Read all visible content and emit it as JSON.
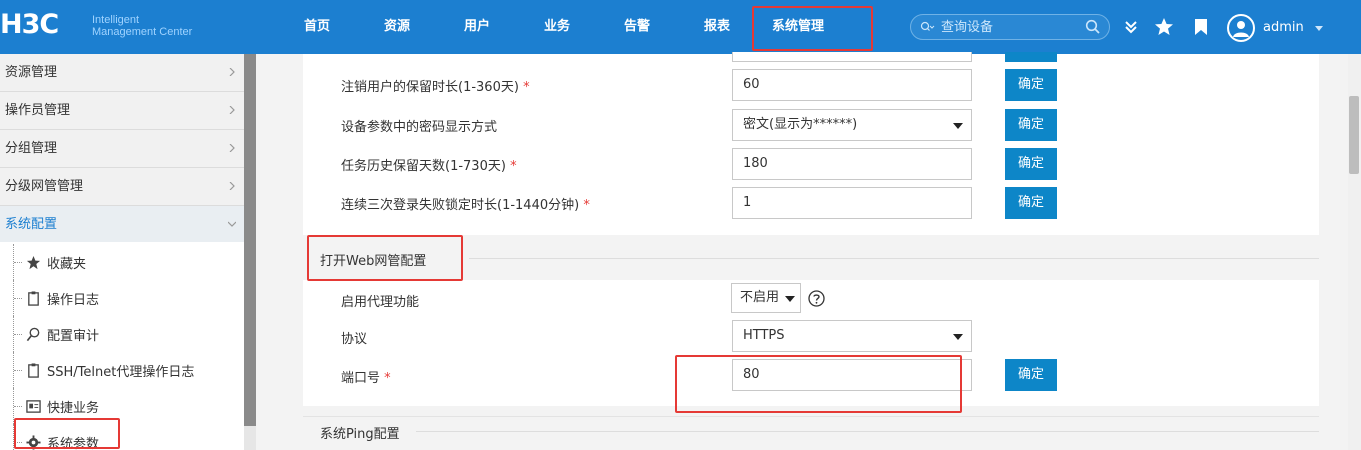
{
  "header": {
    "logo_mark": "H3C",
    "logo_line1": "Intelligent",
    "logo_line2": "Management Center",
    "nav": [
      {
        "label": "首页"
      },
      {
        "label": "资源"
      },
      {
        "label": "用户"
      },
      {
        "label": "业务"
      },
      {
        "label": "告警"
      },
      {
        "label": "报表"
      },
      {
        "label": "系统管理",
        "highlighted": true
      }
    ],
    "search_placeholder": "查询设备",
    "username": "admin",
    "icons": [
      "chevron-double-down-icon",
      "star-icon",
      "bookmark-icon",
      "user-avatar-icon"
    ]
  },
  "sidebar": {
    "items": [
      {
        "label": "资源管理"
      },
      {
        "label": "操作员管理"
      },
      {
        "label": "分组管理"
      },
      {
        "label": "分级网管管理"
      },
      {
        "label": "系统配置",
        "active": true,
        "expanded": true
      }
    ],
    "subitems": [
      {
        "label": "收藏夹",
        "icon": "star-icon"
      },
      {
        "label": "操作日志",
        "icon": "clipboard-icon"
      },
      {
        "label": "配置审计",
        "icon": "audit-search-icon"
      },
      {
        "label": "SSH/Telnet代理操作日志",
        "icon": "clipboard-icon"
      },
      {
        "label": "快捷业务",
        "icon": "id-card-icon"
      },
      {
        "label": "系统参数",
        "icon": "gear-icon",
        "highlighted": true
      }
    ]
  },
  "settings_top": {
    "rows": [
      {
        "label": "注销用户的保留时长(1-360天)",
        "required": true,
        "type": "input",
        "value": "60",
        "button": "确定"
      },
      {
        "label": "设备参数中的密码显示方式",
        "required": false,
        "type": "select",
        "value": "密文(显示为******)",
        "button": "确定"
      },
      {
        "label": "任务历史保留天数(1-730天)",
        "required": true,
        "type": "input",
        "value": "180",
        "button": "确定"
      },
      {
        "label": "连续三次登录失败锁定时长(1-1440分钟)",
        "required": true,
        "type": "input",
        "value": "1",
        "button": "确定"
      }
    ]
  },
  "web_proxy": {
    "title": "打开Web网管配置",
    "proxy_label": "启用代理功能",
    "proxy_value": "不启用",
    "protocol_label": "协议",
    "protocol_value": "HTTPS",
    "port_label": "端口号",
    "port_value": "80",
    "button": "确定"
  },
  "ping": {
    "title": "系统Ping配置"
  },
  "colors": {
    "header_bg": "#1c7fd0",
    "button_bg": "#0d86c8",
    "highlight": "#e53935",
    "required": "#e53935"
  }
}
